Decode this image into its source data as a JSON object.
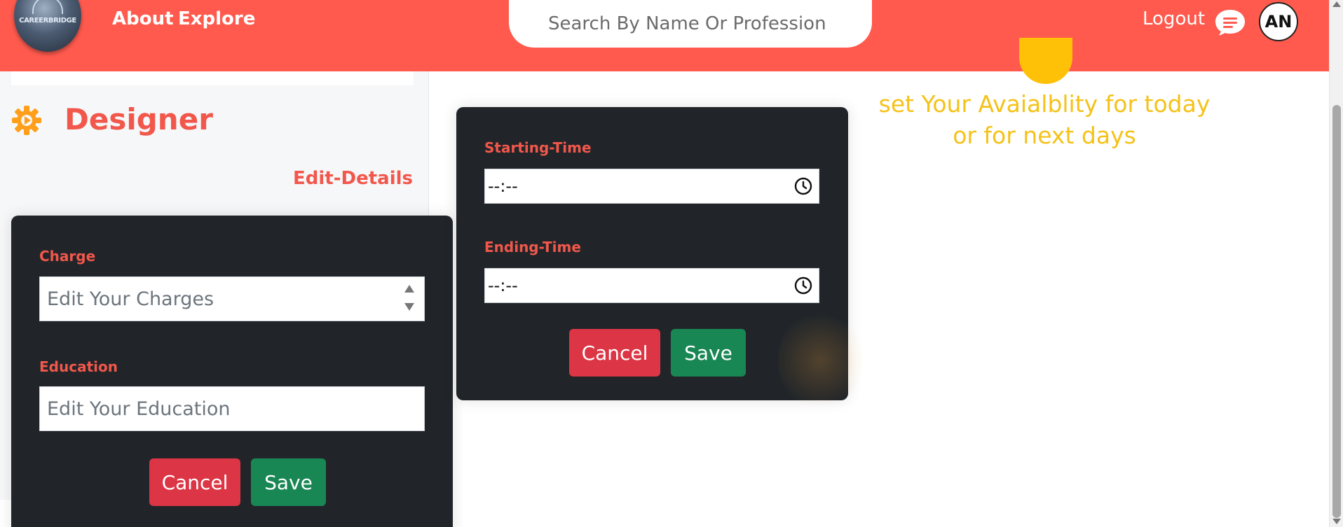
{
  "header": {
    "logo_text": "CAREERBRIDGE",
    "nav": {
      "about": "About",
      "explore": "Explore"
    },
    "search_placeholder": "Search By Name Or Profession",
    "logout": "Logout",
    "avatar_initials": "AN"
  },
  "profile": {
    "profession": "Designer",
    "edit_details": "Edit-Details"
  },
  "details_modal": {
    "charge_label": "Charge",
    "charge_placeholder": "Edit Your Charges",
    "education_label": "Education",
    "education_placeholder": "Edit Your Education",
    "cancel": "Cancel",
    "save": "Save"
  },
  "availability_modal": {
    "start_label": "Starting-Time",
    "start_value": "--:--",
    "end_label": "Ending-Time",
    "end_value": "--:--",
    "cancel": "Cancel",
    "save": "Save"
  },
  "availability_note": {
    "line1": "set Your Avaialblity for today",
    "line2": "or for next days"
  },
  "colors": {
    "brand": "#ff5a4d",
    "accent_text": "#f2574b",
    "card": "#212529",
    "cancel": "#dc3545",
    "save": "#198754",
    "note": "#f5c218"
  }
}
